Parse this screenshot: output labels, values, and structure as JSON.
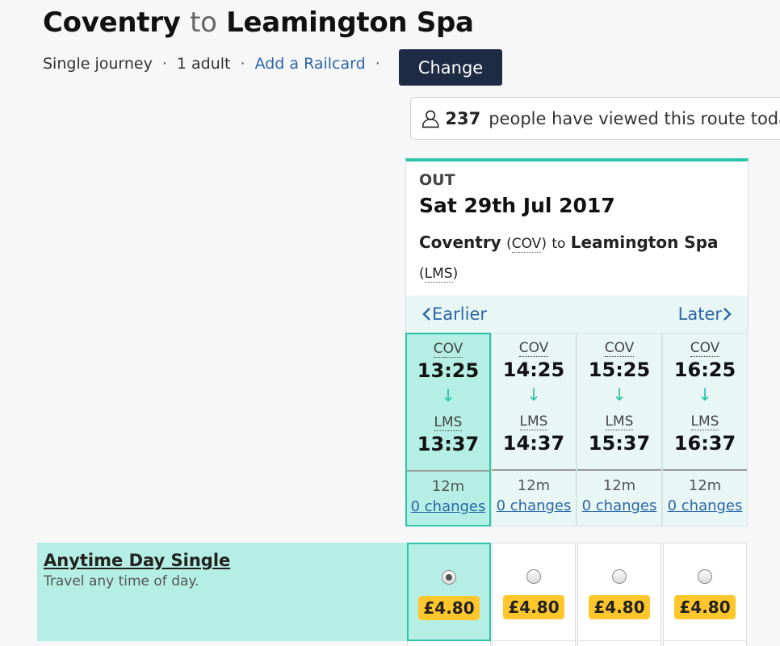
{
  "header": {
    "from": "Coventry",
    "to_word": "to",
    "destination": "Leamington Spa",
    "journey_type": "Single journey",
    "passengers": "1 adult",
    "railcard_link": "Add a Railcard",
    "change_label": "Change",
    "separator": "·"
  },
  "viewers": {
    "icon": "person-icon",
    "count": "237",
    "text": "people have viewed this route toda"
  },
  "out": {
    "label": "OUT",
    "date": "Sat 29th Jul 2017",
    "origin": "Coventry",
    "origin_code": "COV",
    "to_word": "to",
    "destination": "Leamington Spa",
    "destination_code": "LMS",
    "earlier_label": "Earlier",
    "later_label": "Later"
  },
  "journeys": [
    {
      "from_code": "COV",
      "depart": "13:25",
      "to_code": "LMS",
      "arrive": "13:37",
      "duration": "12m",
      "changes": "0 changes",
      "selected": true
    },
    {
      "from_code": "COV",
      "depart": "14:25",
      "to_code": "LMS",
      "arrive": "14:37",
      "duration": "12m",
      "changes": "0 changes",
      "selected": false
    },
    {
      "from_code": "COV",
      "depart": "15:25",
      "to_code": "LMS",
      "arrive": "15:37",
      "duration": "12m",
      "changes": "0 changes",
      "selected": false
    },
    {
      "from_code": "COV",
      "depart": "16:25",
      "to_code": "LMS",
      "arrive": "16:37",
      "duration": "12m",
      "changes": "0 changes",
      "selected": false
    }
  ],
  "fare": {
    "name": "Anytime Day Single",
    "description": "Travel any time of day.",
    "prices": [
      "£4.80",
      "£4.80",
      "£4.80",
      "£4.80"
    ],
    "selected_index": 0
  },
  "colors": {
    "accent": "#2ec4a9",
    "selected_bg": "#b5eee4",
    "button": "#1e2b45",
    "link": "#2a66a8",
    "price_badge": "#ffc72c"
  }
}
